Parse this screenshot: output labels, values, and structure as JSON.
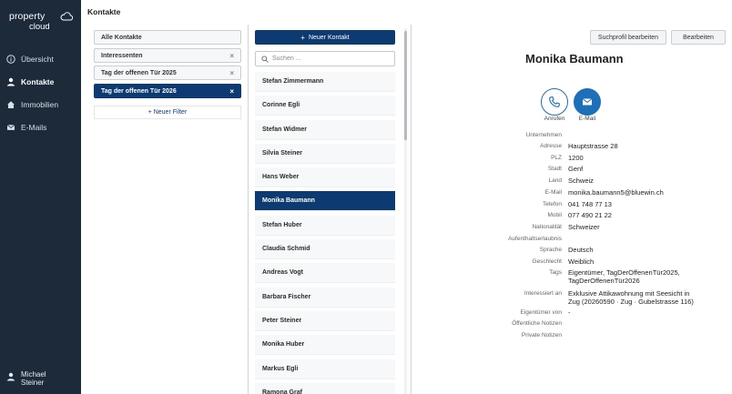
{
  "brand": {
    "line1": "property",
    "line2": "cloud"
  },
  "sidebar": {
    "items": [
      {
        "label": "Übersicht",
        "icon": "info-icon"
      },
      {
        "label": "Kontakte",
        "icon": "person-icon",
        "active": true
      },
      {
        "label": "Immobilien",
        "icon": "home-icon"
      },
      {
        "label": "E-Mails",
        "icon": "mail-icon"
      }
    ],
    "user": {
      "first": "Michael",
      "last": "Steiner"
    }
  },
  "header": {
    "title": "Kontakte"
  },
  "filters": {
    "items": [
      {
        "label": "Alle Kontakte",
        "removable": false
      },
      {
        "label": "Interessenten",
        "removable": true
      },
      {
        "label": "Tag der offenen Tür 2025",
        "removable": true
      },
      {
        "label": "Tag der offenen Tür 2026",
        "removable": true,
        "active": true
      }
    ],
    "remove_symbol": "×",
    "new_filter": "+ Neuer Filter"
  },
  "list": {
    "new_contact": "Neuer Kontakt",
    "new_contact_plus": "+",
    "search_placeholder": "Suchen ...",
    "contacts": [
      "Stefan Zimmermann",
      "Corinne Egli",
      "Stefan Widmer",
      "Silvia Steiner",
      "Hans Weber",
      "Monika Baumann",
      "Stefan Huber",
      "Claudia Schmid",
      "Andreas Vogt",
      "Barbara Fischer",
      "Peter Steiner",
      "Monika Huber",
      "Markus Egli",
      "Ramona Graf"
    ],
    "active_index": 5
  },
  "detail": {
    "buttons": {
      "edit_search": "Suchprofil bearbeiten",
      "edit": "Bearbeiten"
    },
    "name": "Monika Baumann",
    "actions": {
      "call": "Anrufen",
      "email": "E-Mail"
    },
    "fields": [
      {
        "k": "Unternehmen",
        "v": ""
      },
      {
        "k": "Adresse",
        "v": "Hauptstrasse 28"
      },
      {
        "k": "PLZ",
        "v": "1200"
      },
      {
        "k": "Stadt",
        "v": "Genf"
      },
      {
        "k": "Land",
        "v": "Schweiz"
      },
      {
        "k": "E-Mail",
        "v": "monika.baumann5@bluewin.ch"
      },
      {
        "k": "Telefon",
        "v": "041 748 77 13"
      },
      {
        "k": "Mobil",
        "v": "077 490 21 22"
      },
      {
        "k": "Nationalität",
        "v": "Schweizer"
      },
      {
        "k": "Aufenthaltserlaubnis",
        "v": ""
      },
      {
        "k": "Sprache",
        "v": "Deutsch"
      },
      {
        "k": "Geschlecht",
        "v": "Weiblich"
      },
      {
        "k": "Tags",
        "v": "Eigentümer, TagDerOffenenTür2025, TagDerOffenenTür2026"
      },
      {
        "k": "Interessiert an",
        "v": "Exklusive Attikawohnung mit Seesicht in Zug (20260590 · Zug · Gubelstrasse 116)"
      },
      {
        "k": "Eigentümer von",
        "v": "-"
      },
      {
        "k": "Öffentliche Notizen",
        "v": ""
      },
      {
        "k": "Private Notizen",
        "v": ""
      }
    ]
  },
  "colors": {
    "sidebar": "#1c2a3a",
    "primary": "#0d3a70",
    "accent": "#1c6fb8"
  }
}
